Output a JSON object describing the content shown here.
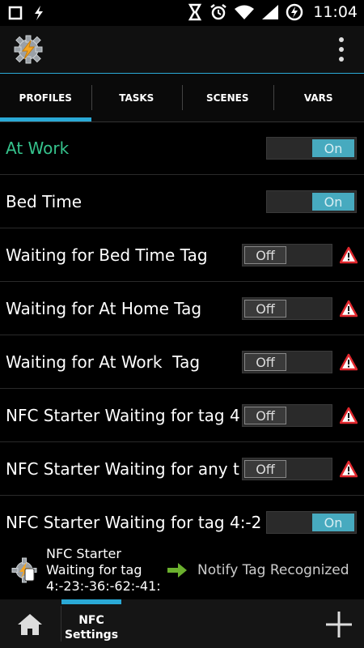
{
  "status_bar": {
    "time": "11:04"
  },
  "app_bar": {
    "logo_icon": "tasker-gear-lightning-icon",
    "menu_icon": "overflow-menu-icon"
  },
  "tabs": [
    {
      "label": "PROFILES",
      "active": true
    },
    {
      "label": "TASKS",
      "active": false
    },
    {
      "label": "SCENES",
      "active": false
    },
    {
      "label": "VARS",
      "active": false
    }
  ],
  "profiles": [
    {
      "name": "At Work",
      "state": "On",
      "highlight": true,
      "warning": false
    },
    {
      "name": "Bed Time",
      "state": "On",
      "highlight": false,
      "warning": false
    },
    {
      "name": "Waiting for Bed Time Tag",
      "state": "Off",
      "highlight": false,
      "warning": true
    },
    {
      "name": "Waiting for At Home Tag",
      "state": "Off",
      "highlight": false,
      "warning": true
    },
    {
      "name": "Waiting for At Work  Tag",
      "state": "Off",
      "highlight": false,
      "warning": true
    },
    {
      "name": "NFC Starter Waiting for tag 4",
      "state": "Off",
      "highlight": false,
      "warning": true
    },
    {
      "name": "NFC Starter Waiting for any t",
      "state": "Off",
      "highlight": false,
      "warning": true
    },
    {
      "name": "NFC Starter Waiting for tag 4:-2",
      "state": "On",
      "highlight": false,
      "warning": false
    }
  ],
  "expanded_profile": {
    "title": "NFC Starter",
    "line1": "Waiting for tag",
    "line2": "4:-23:-36:-62:-41:",
    "task": "Notify Tag Recognized"
  },
  "bottom_bar": {
    "project_tab_line1": "NFC",
    "project_tab_line2": "Settings"
  },
  "colors": {
    "accent": "#2aa9d6",
    "active_profile": "#35c28c",
    "toggle_on": "#47aabf"
  }
}
